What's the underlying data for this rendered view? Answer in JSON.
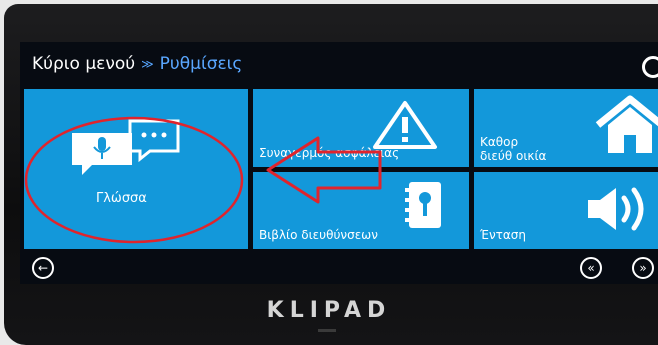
{
  "breadcrumb": {
    "root": "Κύριο μενού",
    "separator": "≫",
    "current": "Ρυθμίσεις"
  },
  "tiles": [
    {
      "label": "Γλώσσα",
      "icon": "speech-bubbles-icon"
    },
    {
      "label": "Συναγερμός ασφάλειας",
      "icon": "warning-triangle-icon"
    },
    {
      "label": "Καθορ\nδιεύθ οικία",
      "icon": "home-icon"
    },
    {
      "label": "Βιβλίο διευθύνσεων",
      "icon": "address-book-icon"
    },
    {
      "label": "Ένταση",
      "icon": "speaker-volume-icon"
    }
  ],
  "brand": "KLIPAD",
  "colors": {
    "tile": "#1398da",
    "breadcrumb_current": "#5aa7ff",
    "annotation": "#e0242c"
  }
}
